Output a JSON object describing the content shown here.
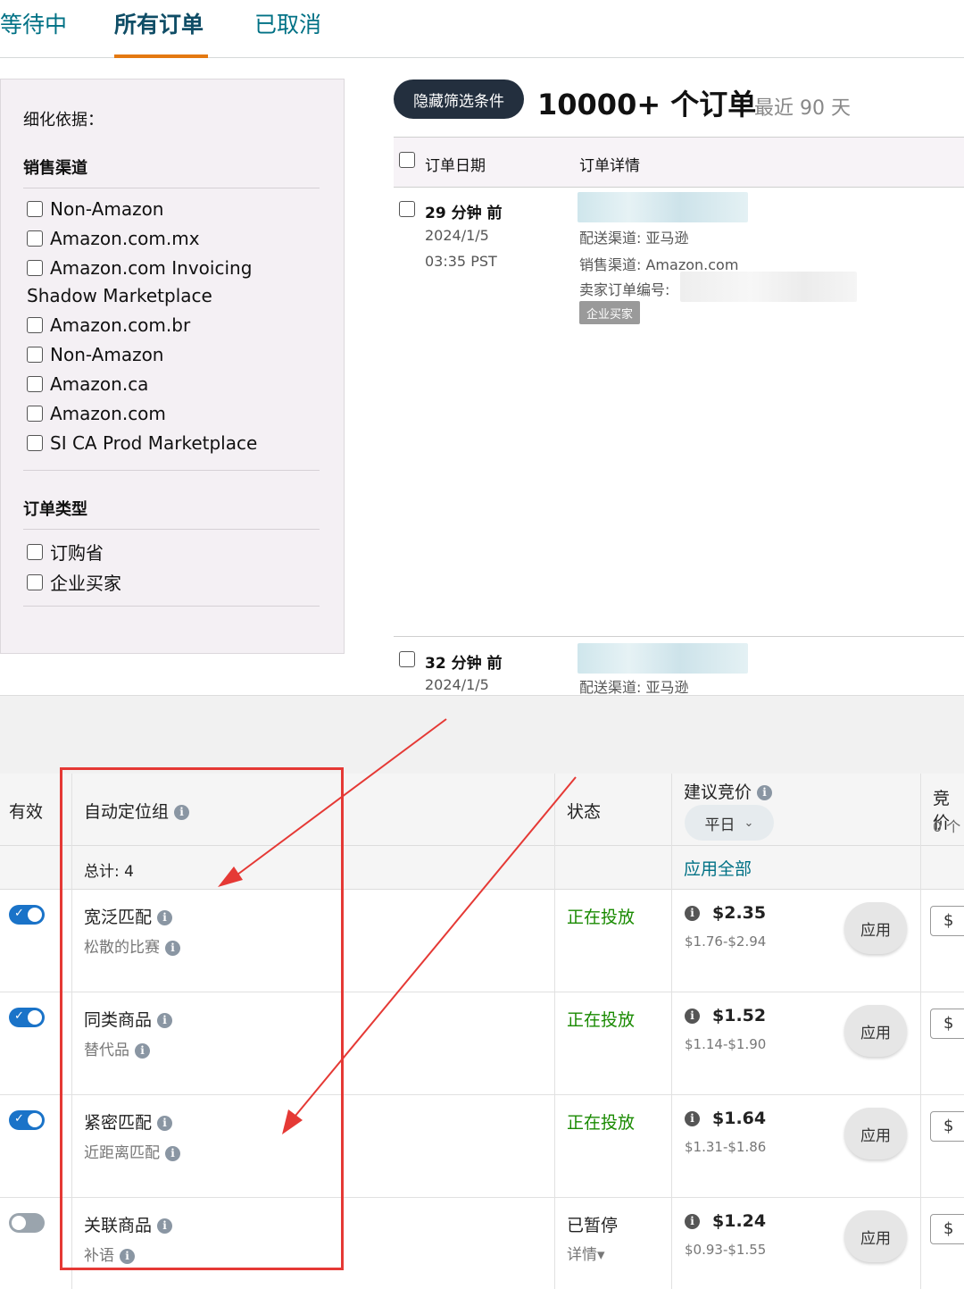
{
  "tabs": [
    {
      "label": "等待中",
      "active": false
    },
    {
      "label": "所有订单",
      "active": true
    },
    {
      "label": "已取消",
      "active": false
    }
  ],
  "filters": {
    "refine_label": "细化依据：",
    "sales_channel": {
      "title": "销售渠道",
      "options": [
        "Non-Amazon",
        "Amazon.com.mx",
        "Amazon.com Invoicing",
        "Shadow Marketplace",
        "Amazon.com.br",
        "Non-Amazon",
        "Amazon.ca",
        "Amazon.com",
        "SI CA Prod Marketplace"
      ]
    },
    "order_type": {
      "title": "订单类型",
      "options": [
        "订购省",
        "企业买家"
      ]
    }
  },
  "orders": {
    "hide_filters_button": "隐藏筛选条件",
    "count": "10000+ 个订单",
    "range": "最近 90 天",
    "columns": [
      "订单日期",
      "订单详情"
    ],
    "rows": [
      {
        "ago": "29 分钟 前",
        "date": "2024/1/5",
        "time": "03:35 PST",
        "fulfillment": "配送渠道: 亚马逊",
        "sales_channel": "销售渠道: Amazon.com",
        "seller_order_id": "卖家订单编号:",
        "badge": "企业买家"
      },
      {
        "ago": "32 分钟 前",
        "date": "2024/1/5",
        "fulfillment": "配送渠道: 亚马逊"
      }
    ]
  },
  "targeting": {
    "columns": {
      "active": "有效",
      "auto_group": "自动定位组",
      "status": "状态",
      "suggested_bid": "建议竞价",
      "bid_partial": "竞价",
      "bid_partial_sub": "0 个"
    },
    "bid_dropdown": "平日",
    "total": "总计: 4",
    "apply_all": "应用全部",
    "rows": [
      {
        "name": "宽泛匹配",
        "sub": "松散的比赛",
        "enabled": true,
        "status": "正在投放",
        "bid": "$2.35",
        "range": "$1.76-$2.94",
        "apply": "应用",
        "currency": "$"
      },
      {
        "name": "同类商品",
        "sub": "替代品",
        "enabled": true,
        "status": "正在投放",
        "bid": "$1.52",
        "range": "$1.14-$1.90",
        "apply": "应用",
        "currency": "$"
      },
      {
        "name": "紧密匹配",
        "sub": "近距离匹配",
        "enabled": true,
        "status": "正在投放",
        "bid": "$1.64",
        "range": "$1.31-$1.86",
        "apply": "应用",
        "currency": "$"
      },
      {
        "name": "关联商品",
        "sub": "补语",
        "enabled": false,
        "status": "已暂停",
        "detail": "详情▾",
        "bid": "$1.24",
        "range": "$0.93-$1.55",
        "apply": "应用",
        "currency": "$"
      }
    ]
  },
  "colors": {
    "link": "#007185",
    "active_tab_underline": "#e47911",
    "running_status": "#198a00",
    "toggle_on": "#1a73c8",
    "annotation_red": "#e53935"
  }
}
